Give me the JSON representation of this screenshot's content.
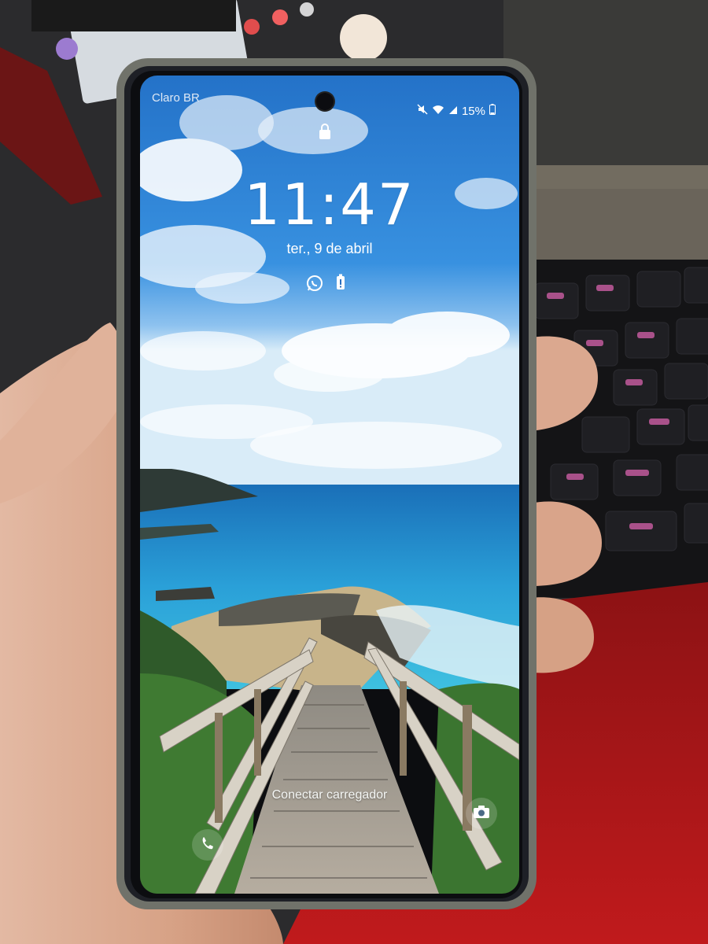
{
  "lockscreen": {
    "carrier": "Claro BR",
    "battery_percent": "15%",
    "time": "11:47",
    "date": "ter., 9 de abril",
    "charger_hint": "Conectar carregador"
  },
  "notification_icons": [
    "whatsapp-icon",
    "battery-alert-icon"
  ],
  "shortcuts": [
    "phone-icon",
    "camera-icon"
  ],
  "colors": {
    "sky": "#2f86dc",
    "sea": "#1e8fc9",
    "phone_case": "#77786f",
    "table": "#b2161a"
  }
}
